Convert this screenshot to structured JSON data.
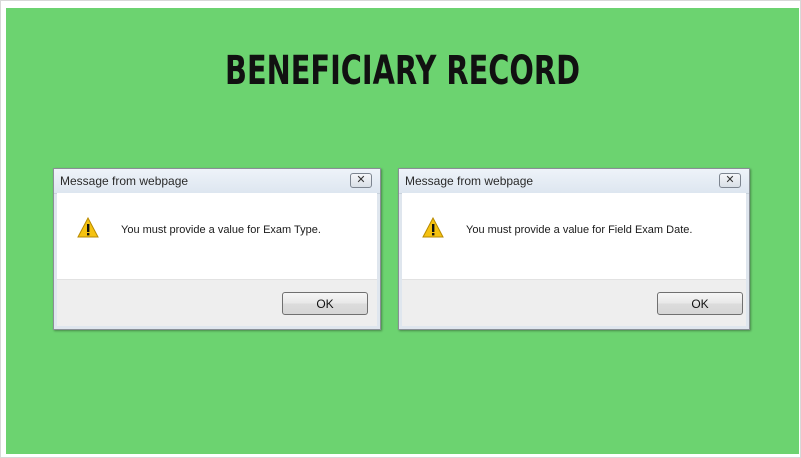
{
  "page": {
    "title": "BENEFICIARY RECORD",
    "background_color": "#6cd370"
  },
  "dialogs": [
    {
      "window_title": "Message from webpage",
      "close_glyph": "✕",
      "icon": "warning-icon",
      "message": "You must provide a value for Exam Type.",
      "ok_label": "OK"
    },
    {
      "window_title": "Message from webpage",
      "close_glyph": "✕",
      "icon": "warning-icon",
      "message": "You must provide a value for Field Exam Date.",
      "ok_label": "OK"
    }
  ]
}
